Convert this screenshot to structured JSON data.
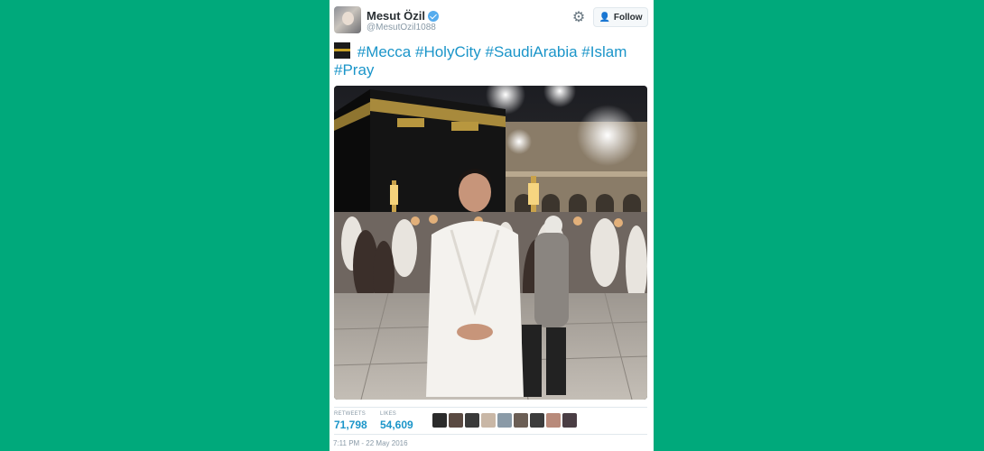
{
  "user": {
    "name": "Mesut Özil",
    "handle": "@MesutOzil1088",
    "verified": true
  },
  "follow_label": "Follow",
  "tweet": {
    "emoji": "kaaba-emoji",
    "hashtags": [
      "#Mecca",
      "#HolyCity",
      "#SaudiArabia",
      "#Islam",
      "#Pray"
    ]
  },
  "stats": {
    "retweets_label": "RETWEETS",
    "retweets_value": "71,798",
    "likes_label": "LIKES",
    "likes_value": "54,609"
  },
  "likers": [
    "#2b2b2b",
    "#5a4a42",
    "#3a3a3a",
    "#c9b7a6",
    "#8a9aa7",
    "#6b5e55",
    "#3c3c3c",
    "#b88a7a",
    "#4a3e44"
  ],
  "timestamp": "7:11 PM - 22 May 2016",
  "colors": {
    "background": "#00a97b",
    "link": "#1b95c9",
    "verified": "#55acee"
  },
  "icons": {
    "settings": "gear-icon",
    "follow": "add-person-icon"
  }
}
